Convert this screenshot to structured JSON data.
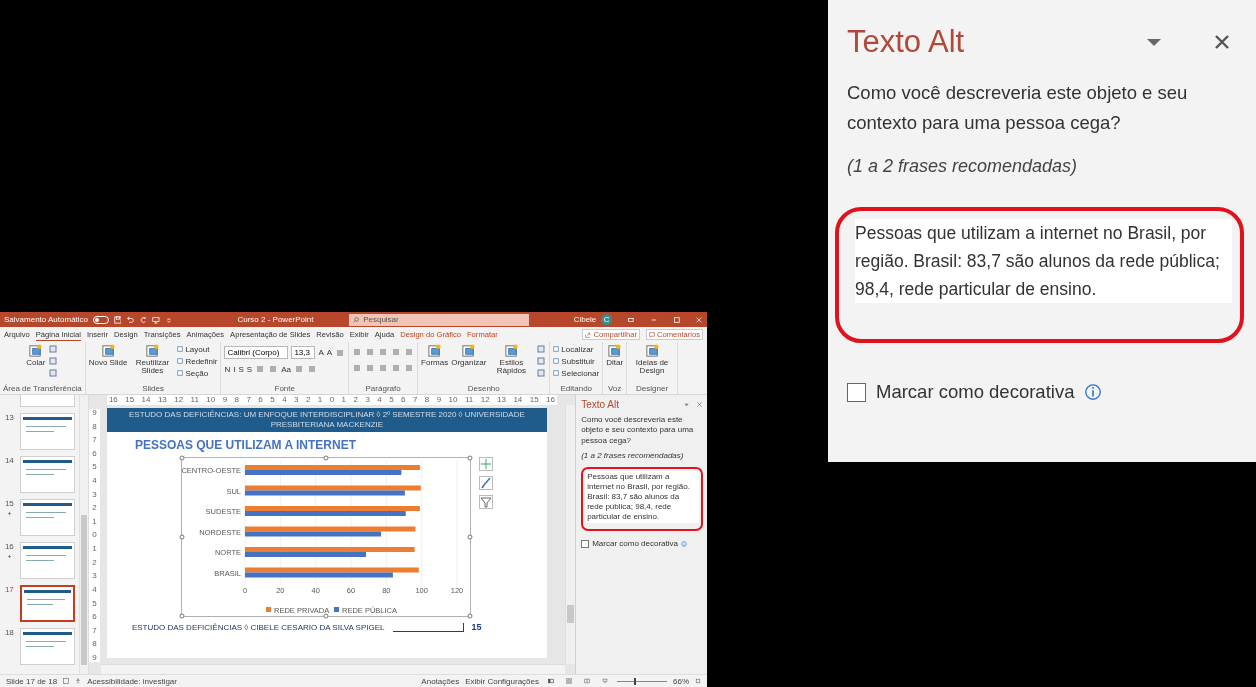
{
  "powerpoint": {
    "title_bar": {
      "autosave_label": "Salvamento Automático",
      "autosave_on": false,
      "document_title": "Curso 2 - PowerPoint",
      "search_placeholder": "Pesquisar",
      "user_name": "Cibele",
      "user_initial": "C"
    },
    "tabs": [
      {
        "label": "Arquivo",
        "selected": false,
        "kind": "standard"
      },
      {
        "label": "Página Inicial",
        "selected": true,
        "kind": "standard"
      },
      {
        "label": "Inserir",
        "selected": false,
        "kind": "standard"
      },
      {
        "label": "Design",
        "selected": false,
        "kind": "standard"
      },
      {
        "label": "Transições",
        "selected": false,
        "kind": "standard"
      },
      {
        "label": "Animações",
        "selected": false,
        "kind": "standard"
      },
      {
        "label": "Apresentação de Slides",
        "selected": false,
        "kind": "standard"
      },
      {
        "label": "Revisão",
        "selected": false,
        "kind": "standard"
      },
      {
        "label": "Exibir",
        "selected": false,
        "kind": "standard"
      },
      {
        "label": "Ajuda",
        "selected": false,
        "kind": "standard"
      },
      {
        "label": "Design do Gráfico",
        "selected": false,
        "kind": "contextual"
      },
      {
        "label": "Formatar",
        "selected": false,
        "kind": "contextual"
      }
    ],
    "share_button": "Compartilhar",
    "comments_button": "Comentários",
    "ribbon": [
      {
        "label": "Área de Transferência",
        "kind": "columns",
        "items": [
          {
            "kind": "large",
            "label": "Colar"
          },
          {
            "kind": "icon"
          },
          {
            "kind": "icon"
          },
          {
            "kind": "icon"
          }
        ]
      },
      {
        "label": "Slides",
        "kind": "columns",
        "items": [
          {
            "kind": "large",
            "label": "Novo Slide"
          },
          {
            "kind": "large",
            "label": "Reutilizar Slides"
          },
          {
            "kind": "small",
            "label": "Layout"
          },
          {
            "kind": "small",
            "label": "Redefinir"
          },
          {
            "kind": "small",
            "label": "Seção"
          }
        ]
      },
      {
        "label": "Fonte",
        "kind": "lines",
        "lines": [
          {
            "items": [
              {
                "kind": "field",
                "value": "Calibri (Corpo)"
              },
              {
                "kind": "field",
                "value": "13,3"
              },
              {
                "kind": "glyph",
                "label": "A"
              },
              {
                "kind": "glyph",
                "label": "A"
              },
              {
                "kind": "icon"
              }
            ]
          },
          {
            "items": [
              {
                "kind": "glyph",
                "label": "N"
              },
              {
                "kind": "glyph",
                "label": "I"
              },
              {
                "kind": "glyph",
                "label": "S"
              },
              {
                "kind": "glyph",
                "label": "S"
              },
              {
                "kind": "icon"
              },
              {
                "kind": "icon"
              },
              {
                "kind": "glyph",
                "label": "Aa"
              },
              {
                "kind": "icon"
              },
              {
                "kind": "icon"
              }
            ]
          }
        ]
      },
      {
        "label": "Parágrafo",
        "kind": "lines",
        "lines": [
          {
            "items": [
              {
                "kind": "icon"
              },
              {
                "kind": "icon"
              },
              {
                "kind": "icon"
              },
              {
                "kind": "icon"
              },
              {
                "kind": "icon"
              }
            ]
          },
          {
            "items": [
              {
                "kind": "icon"
              },
              {
                "kind": "icon"
              },
              {
                "kind": "icon"
              },
              {
                "kind": "icon"
              },
              {
                "kind": "icon"
              }
            ]
          }
        ]
      },
      {
        "label": "Desenho",
        "kind": "columns",
        "items": [
          {
            "kind": "large",
            "label": "Formas"
          },
          {
            "kind": "large",
            "label": "Organizar"
          },
          {
            "kind": "large",
            "label": "Estilos Rápidos"
          },
          {
            "kind": "icon"
          },
          {
            "kind": "icon"
          },
          {
            "kind": "icon"
          }
        ]
      },
      {
        "label": "Editando",
        "kind": "columns",
        "items": [
          {
            "kind": "small",
            "label": "Localizar"
          },
          {
            "kind": "small",
            "label": "Substituir"
          },
          {
            "kind": "small",
            "label": "Selecionar"
          }
        ]
      },
      {
        "label": "Voz",
        "kind": "columns",
        "items": [
          {
            "kind": "large",
            "label": "Ditar"
          }
        ]
      },
      {
        "label": "Designer",
        "kind": "columns",
        "items": [
          {
            "kind": "large",
            "label": "Ideias de Design"
          }
        ]
      }
    ],
    "thumbnails": [
      {
        "number": "13",
        "selected": false,
        "animated": false
      },
      {
        "number": "14",
        "selected": false,
        "animated": false
      },
      {
        "number": "15",
        "selected": false,
        "animated": true
      },
      {
        "number": "16",
        "selected": false,
        "animated": true
      },
      {
        "number": "17",
        "selected": true,
        "animated": false
      },
      {
        "number": "18",
        "selected": false,
        "animated": false
      }
    ],
    "horizontal_ruler": [
      "16",
      "15",
      "14",
      "13",
      "12",
      "11",
      "10",
      "9",
      "8",
      "7",
      "6",
      "5",
      "4",
      "3",
      "2",
      "1",
      "0",
      "1",
      "2",
      "3",
      "4",
      "5",
      "6",
      "7",
      "8",
      "9",
      "10",
      "11",
      "12",
      "13",
      "14",
      "15",
      "16"
    ],
    "vertical_ruler": [
      "9",
      "8",
      "7",
      "6",
      "5",
      "4",
      "3",
      "2",
      "1",
      "0",
      "1",
      "2",
      "3",
      "4",
      "5",
      "6",
      "7",
      "8",
      "9"
    ],
    "slide": {
      "header": "ESTUDO DAS DEFICIÊNCIAS: UM ENFOQUE INTERDISCIPLINAR ◊ 2º SEMESTRE 2020 ◊ UNIVERSIDADE PRESBITERIANA MACKENZIE",
      "title": "PESSOAS QUE UTILIZAM A INTERNET",
      "chart_data": {
        "type": "bar",
        "orientation": "horizontal",
        "grid": true,
        "legend": "bottom",
        "categories": [
          "CENTRO-OESTE",
          "SUL",
          "SUDESTE",
          "NORDESTE",
          "NORTE",
          "BRASIL"
        ],
        "series": [
          {
            "name": "REDE PRIVADA",
            "color": "#ed7d31",
            "values": [
              99,
              99.5,
              99,
              96.5,
              96,
              98.4
            ]
          },
          {
            "name": "REDE PÚBLICA",
            "color": "#4472c4",
            "values": [
              88.5,
              90.5,
              91,
              77,
              68.5,
              83.7
            ]
          }
        ],
        "xlim": [
          0,
          120
        ],
        "xticks": [
          0,
          20,
          40,
          60,
          80,
          100,
          120
        ]
      },
      "footer": "ESTUDO DAS DEFICIÊNCIAS ◊ CIBELE CESARIO DA SILVA SPIGEL",
      "page_number": "15"
    },
    "alt_text_pane": {
      "title": "Texto Alt",
      "question": "Como você descreveria este objeto e seu contexto para uma pessoa cega?",
      "hint": "(1 a 2 frases recomendadas)",
      "description": "Pessoas que utilizam a internet no Brasil, por região. Brasil: 83,7 são alunos da rede pública; 98,4, rede particular de ensino.",
      "decorative_label": "Marcar como decorativa",
      "decorative_checked": false
    },
    "status_bar": {
      "slide_count": "Slide 17 de 18",
      "accessibility": "Acessibilidade: investigar",
      "notes": "Anotações",
      "display_settings": "Exibir Configurações",
      "zoom_slider": {
        "level": 0.35
      },
      "zoom": "66%"
    }
  },
  "alt_text_zoom": {
    "title": "Texto Alt",
    "question": "Como você descreveria este objeto e seu contexto para uma pessoa cega?",
    "hint": "(1 a 2 frases recomendadas)",
    "description": "Pessoas que utilizam a internet no Brasil, por região. Brasil: 83,7 são alunos da rede pública; 98,4, rede particular de ensino.",
    "decorative_label": "Marcar como decorativa",
    "decorative_checked": false
  }
}
